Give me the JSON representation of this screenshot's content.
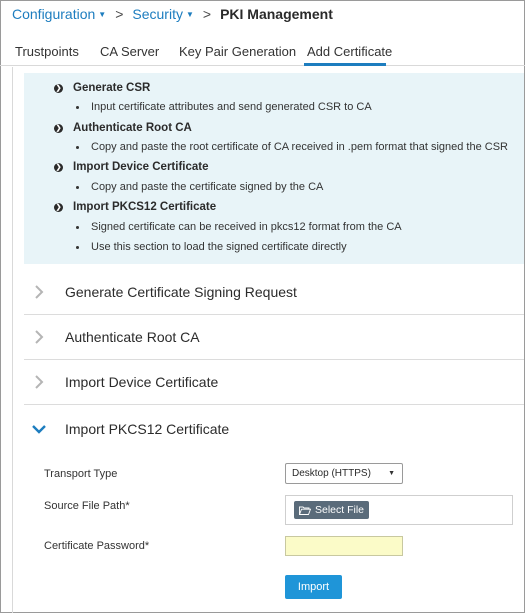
{
  "breadcrumb": {
    "configuration": "Configuration",
    "security": "Security",
    "current": "PKI Management"
  },
  "tabs": [
    {
      "label": "Trustpoints"
    },
    {
      "label": "CA Server"
    },
    {
      "label": "Key Pair Generation"
    },
    {
      "label": "Add Certificate",
      "active": true
    }
  ],
  "info": {
    "sections": [
      {
        "heading": "Generate CSR",
        "items": [
          "Input certificate attributes and send generated CSR to CA"
        ]
      },
      {
        "heading": "Authenticate Root CA",
        "items": [
          "Copy and paste the root certificate of CA received in .pem format that signed the CSR"
        ]
      },
      {
        "heading": "Import Device Certificate",
        "items": [
          "Copy and paste the certificate signed by the CA"
        ]
      },
      {
        "heading": "Import PKCS12 Certificate",
        "items": [
          "Signed certificate can be received in pkcs12 format from the CA",
          "Use this section to load the signed certificate directly"
        ]
      }
    ]
  },
  "accordion": [
    {
      "title": "Generate Certificate Signing Request",
      "expanded": false
    },
    {
      "title": "Authenticate Root CA",
      "expanded": false
    },
    {
      "title": "Import Device Certificate",
      "expanded": false
    },
    {
      "title": "Import PKCS12 Certificate",
      "expanded": true
    }
  ],
  "form": {
    "transport_label": "Transport Type",
    "transport_value": "Desktop (HTTPS)",
    "source_label": "Source File Path*",
    "select_file_label": "Select File",
    "password_label": "Certificate Password*",
    "password_value": "",
    "import_label": "Import"
  },
  "colors": {
    "link": "#1d7dbf",
    "info_bg": "#e8f4f8",
    "password_bg": "#fbfbc8",
    "import_button": "#1f95d8",
    "select_file_button": "#5a6b7a"
  }
}
